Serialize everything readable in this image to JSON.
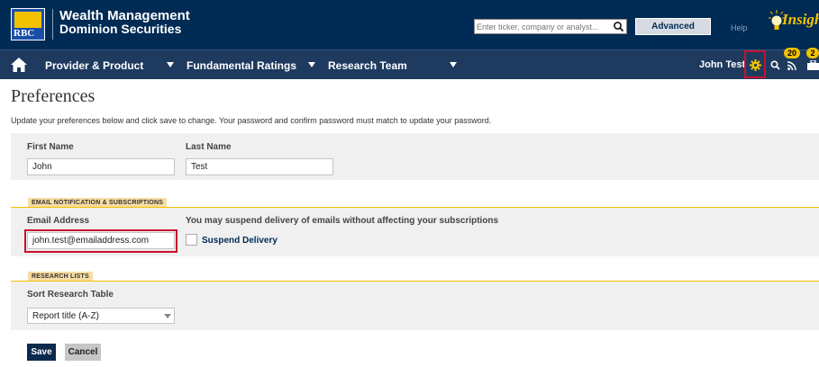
{
  "header": {
    "logo_text": "RBC",
    "brand_line1": "Wealth Management",
    "brand_line2": "Dominion Securities",
    "search_placeholder": "Enter ticker, company or analyst...",
    "advanced_search_label": "Advanced Search",
    "help_label": "Help",
    "insight_label": "Insight"
  },
  "nav": {
    "items": [
      {
        "label": "Provider & Product"
      },
      {
        "label": "Fundamental Ratings"
      },
      {
        "label": "Research Team"
      }
    ],
    "user_name": "John Test",
    "badges": {
      "alerts": "20",
      "briefcase": "2"
    }
  },
  "page": {
    "title": "Preferences",
    "description": "Update your preferences below and click save to change. Your password and confirm password must match to update your password."
  },
  "profile": {
    "first_name_label": "First Name",
    "first_name_value": "John",
    "last_name_label": "Last Name",
    "last_name_value": "Test"
  },
  "email_section": {
    "tag": "EMAIL NOTIFICATION & SUBSCRIPTIONS",
    "email_label": "Email Address",
    "email_value": "john.test@emailaddress.com",
    "suspend_note": "You may suspend delivery of emails without affecting your subscriptions",
    "suspend_label": "Suspend Delivery",
    "suspend_checked": false
  },
  "research_section": {
    "tag": "RESEARCH LISTS",
    "sort_label": "Sort Research Table",
    "sort_value": "Report title (A-Z)"
  },
  "actions": {
    "save_label": "Save",
    "cancel_label": "Cancel"
  },
  "colors": {
    "header_bg": "#002b54",
    "nav_bg": "#1e3a5f",
    "accent_gold": "#f2c200",
    "highlight_red": "#c8102e",
    "link_navy": "#002b54"
  },
  "icons": [
    "home-icon",
    "search-icon",
    "gear-icon",
    "rss-icon",
    "briefcase-icon",
    "chevron-down-icon",
    "lightbulb-icon"
  ]
}
